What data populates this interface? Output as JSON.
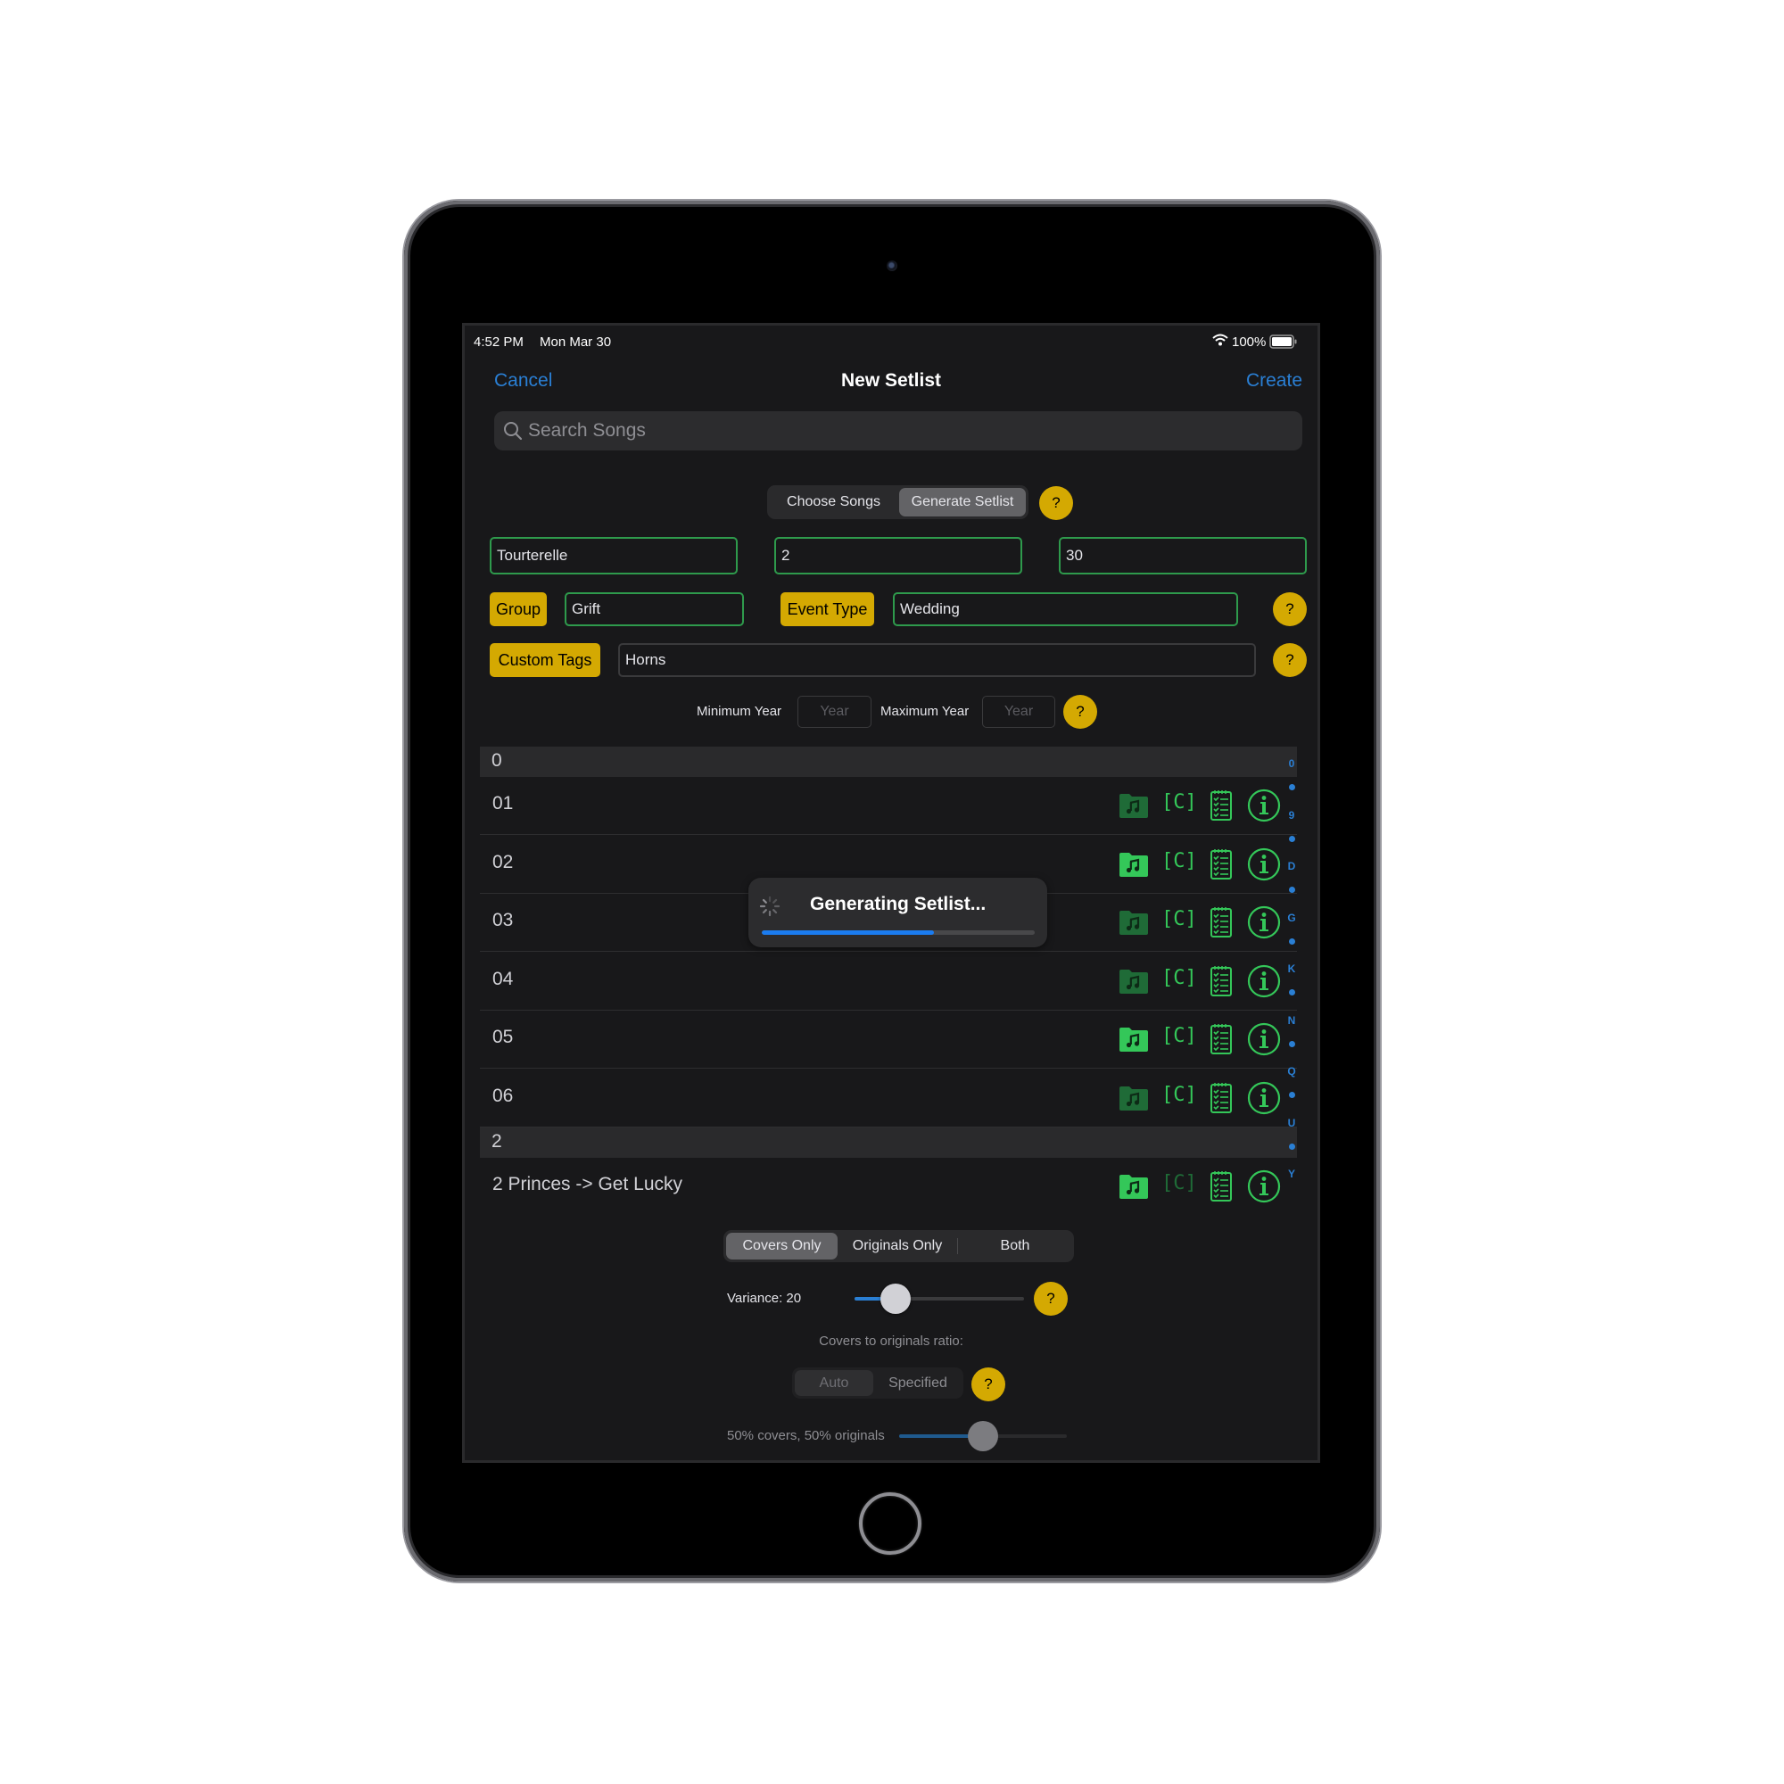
{
  "status_bar": {
    "time": "4:52 PM",
    "date": "Mon Mar 30",
    "wifi_icon": "wifi-icon",
    "battery_percent": "100%",
    "battery_icon": "battery-full-icon"
  },
  "nav": {
    "cancel_label": "Cancel",
    "title": "New Setlist",
    "create_label": "Create"
  },
  "search": {
    "placeholder": "Search Songs",
    "icon": "search-icon"
  },
  "mode_segment": {
    "options": [
      "Choose Songs",
      "Generate Setlist"
    ],
    "selected": "Generate Setlist",
    "help_label": "?"
  },
  "setlist_fields": {
    "name_value": "Tourterelle",
    "sets_value": "2",
    "songs_value": "30"
  },
  "filters": {
    "group_label": "Group",
    "group_value": "Grift",
    "event_type_label": "Event Type",
    "event_type_value": "Wedding",
    "custom_tags_label": "Custom Tags",
    "custom_tags_value": "Horns",
    "help_label": "?"
  },
  "years": {
    "min_label": "Minimum Year",
    "min_placeholder": "Year",
    "max_label": "Maximum Year",
    "max_placeholder": "Year",
    "help_label": "?"
  },
  "song_list": {
    "sections": [
      {
        "header": "0",
        "rows": [
          {
            "name": "01",
            "folder_active": false,
            "chords_active": true
          },
          {
            "name": "02",
            "folder_active": true,
            "chords_active": true
          },
          {
            "name": "03",
            "folder_active": false,
            "chords_active": true
          },
          {
            "name": "04",
            "folder_active": false,
            "chords_active": true
          },
          {
            "name": "05",
            "folder_active": true,
            "chords_active": true
          },
          {
            "name": "06",
            "folder_active": false,
            "chords_active": true
          }
        ]
      },
      {
        "header": "2",
        "rows": [
          {
            "name": "2 Princes -> Get Lucky",
            "folder_active": true,
            "chords_active": false
          }
        ]
      }
    ],
    "row_icons": [
      "music-folder-icon",
      "chords-icon",
      "checklist-icon",
      "info-icon"
    ],
    "chords_glyph": "[C]",
    "section_index": [
      "0",
      "9",
      "D",
      "G",
      "K",
      "N",
      "Q",
      "U",
      "Y"
    ]
  },
  "loading": {
    "text": "Generating Setlist...",
    "progress": 0.63
  },
  "song_type_segment": {
    "options": [
      "Covers Only",
      "Originals Only",
      "Both"
    ],
    "selected": "Covers Only"
  },
  "variance": {
    "label": "Variance: 20",
    "value": 20,
    "fraction": 0.24,
    "help_label": "?"
  },
  "ratio": {
    "caption": "Covers to originals ratio:",
    "mode_options": [
      "Auto",
      "Specified"
    ],
    "mode_selected": "Auto",
    "help_label": "?",
    "value_label": "50% covers, 50% originals",
    "fraction": 0.5
  },
  "colors": {
    "accent_blue": "#2a7fd4",
    "help_yellow": "#d4a902",
    "field_green": "#2e9a4c",
    "icon_green": "#34c759",
    "icon_green_dim": "#1f6b37"
  }
}
